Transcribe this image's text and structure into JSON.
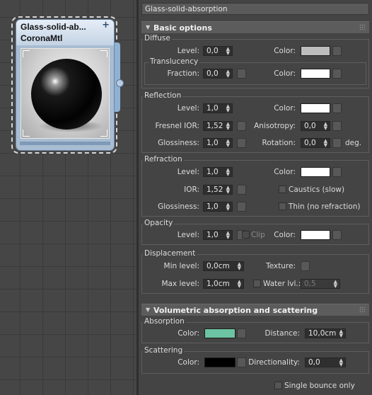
{
  "node": {
    "title": "Glass-solid-ab...",
    "type": "CoronaMtl",
    "plus": "+"
  },
  "panel": {
    "material_name": "Glass-solid-absorption",
    "basic_options": {
      "title": "Basic options",
      "diffuse": {
        "group": "Diffuse",
        "level_label": "Level:",
        "level": "0,0",
        "color_label": "Color:",
        "color": "#bdbdbd"
      },
      "translucency": {
        "group": "Translucency",
        "fraction_label": "Fraction:",
        "fraction": "0,0",
        "color_label": "Color:",
        "color": "#ffffff"
      },
      "reflection": {
        "group": "Reflection",
        "level_label": "Level:",
        "level": "1,0",
        "color_label": "Color:",
        "color": "#ffffff",
        "fresnel_label": "Fresnel IOR:",
        "fresnel": "1,52",
        "aniso_label": "Anisotropy:",
        "aniso": "0,0",
        "gloss_label": "Glossiness:",
        "gloss": "1,0",
        "rotation_label": "Rotation:",
        "rotation": "0,0",
        "deg": "deg."
      },
      "refraction": {
        "group": "Refraction",
        "level_label": "Level:",
        "level": "1,0",
        "color_label": "Color:",
        "color": "#ffffff",
        "ior_label": "IOR:",
        "ior": "1,52",
        "caustics_label": "Caustics (slow)",
        "gloss_label": "Glossiness:",
        "gloss": "1,0",
        "thin_label": "Thin (no refraction)"
      },
      "opacity": {
        "group": "Opacity",
        "level_label": "Level:",
        "level": "1,0",
        "clip_label": "Clip",
        "color_label": "Color:",
        "color": "#ffffff"
      },
      "displacement": {
        "group": "Displacement",
        "min_label": "Min level:",
        "min": "0,0cm",
        "texture_label": "Texture:",
        "max_label": "Max level:",
        "max": "1,0cm",
        "water_label": "Water lvl.:",
        "water": "0,5"
      }
    },
    "volumetric": {
      "title": "Volumetric absorption and scattering",
      "absorption": {
        "group": "Absorption",
        "color_label": "Color:",
        "color": "#6cc4a2",
        "distance_label": "Distance:",
        "distance": "10,0cm"
      },
      "scattering": {
        "group": "Scattering",
        "color_label": "Color:",
        "color": "#000000",
        "dir_label": "Directionality:",
        "dir": "0,0"
      },
      "single_bounce_label": "Single bounce only"
    }
  }
}
